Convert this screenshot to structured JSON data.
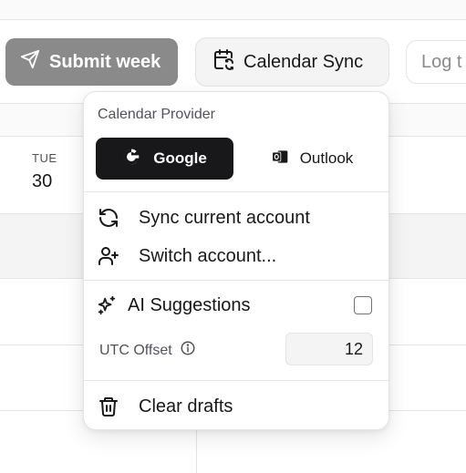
{
  "toolbar": {
    "submit_label": "Submit week",
    "calendar_sync_label": "Calendar Sync",
    "log_placeholder": "Log t"
  },
  "calendar": {
    "day_name": "TUE",
    "day_number": "30"
  },
  "calendar_menu": {
    "provider_heading": "Calendar Provider",
    "providers": [
      {
        "label": "Google",
        "icon": "google-icon",
        "selected": true
      },
      {
        "label": "Outlook",
        "icon": "outlook-icon",
        "selected": false
      }
    ],
    "sync_current_label": "Sync current account",
    "switch_account_label": "Switch account...",
    "ai_suggestions_label": "AI Suggestions",
    "ai_suggestions_checked": false,
    "utc_offset_label": "UTC Offset",
    "utc_offset_value": "12",
    "clear_drafts_label": "Clear drafts"
  },
  "colors": {
    "primary_dark": "#18181b",
    "submit_disabled": "#8a8a8a",
    "border": "#e4e4e7",
    "muted_text": "#52525b"
  }
}
